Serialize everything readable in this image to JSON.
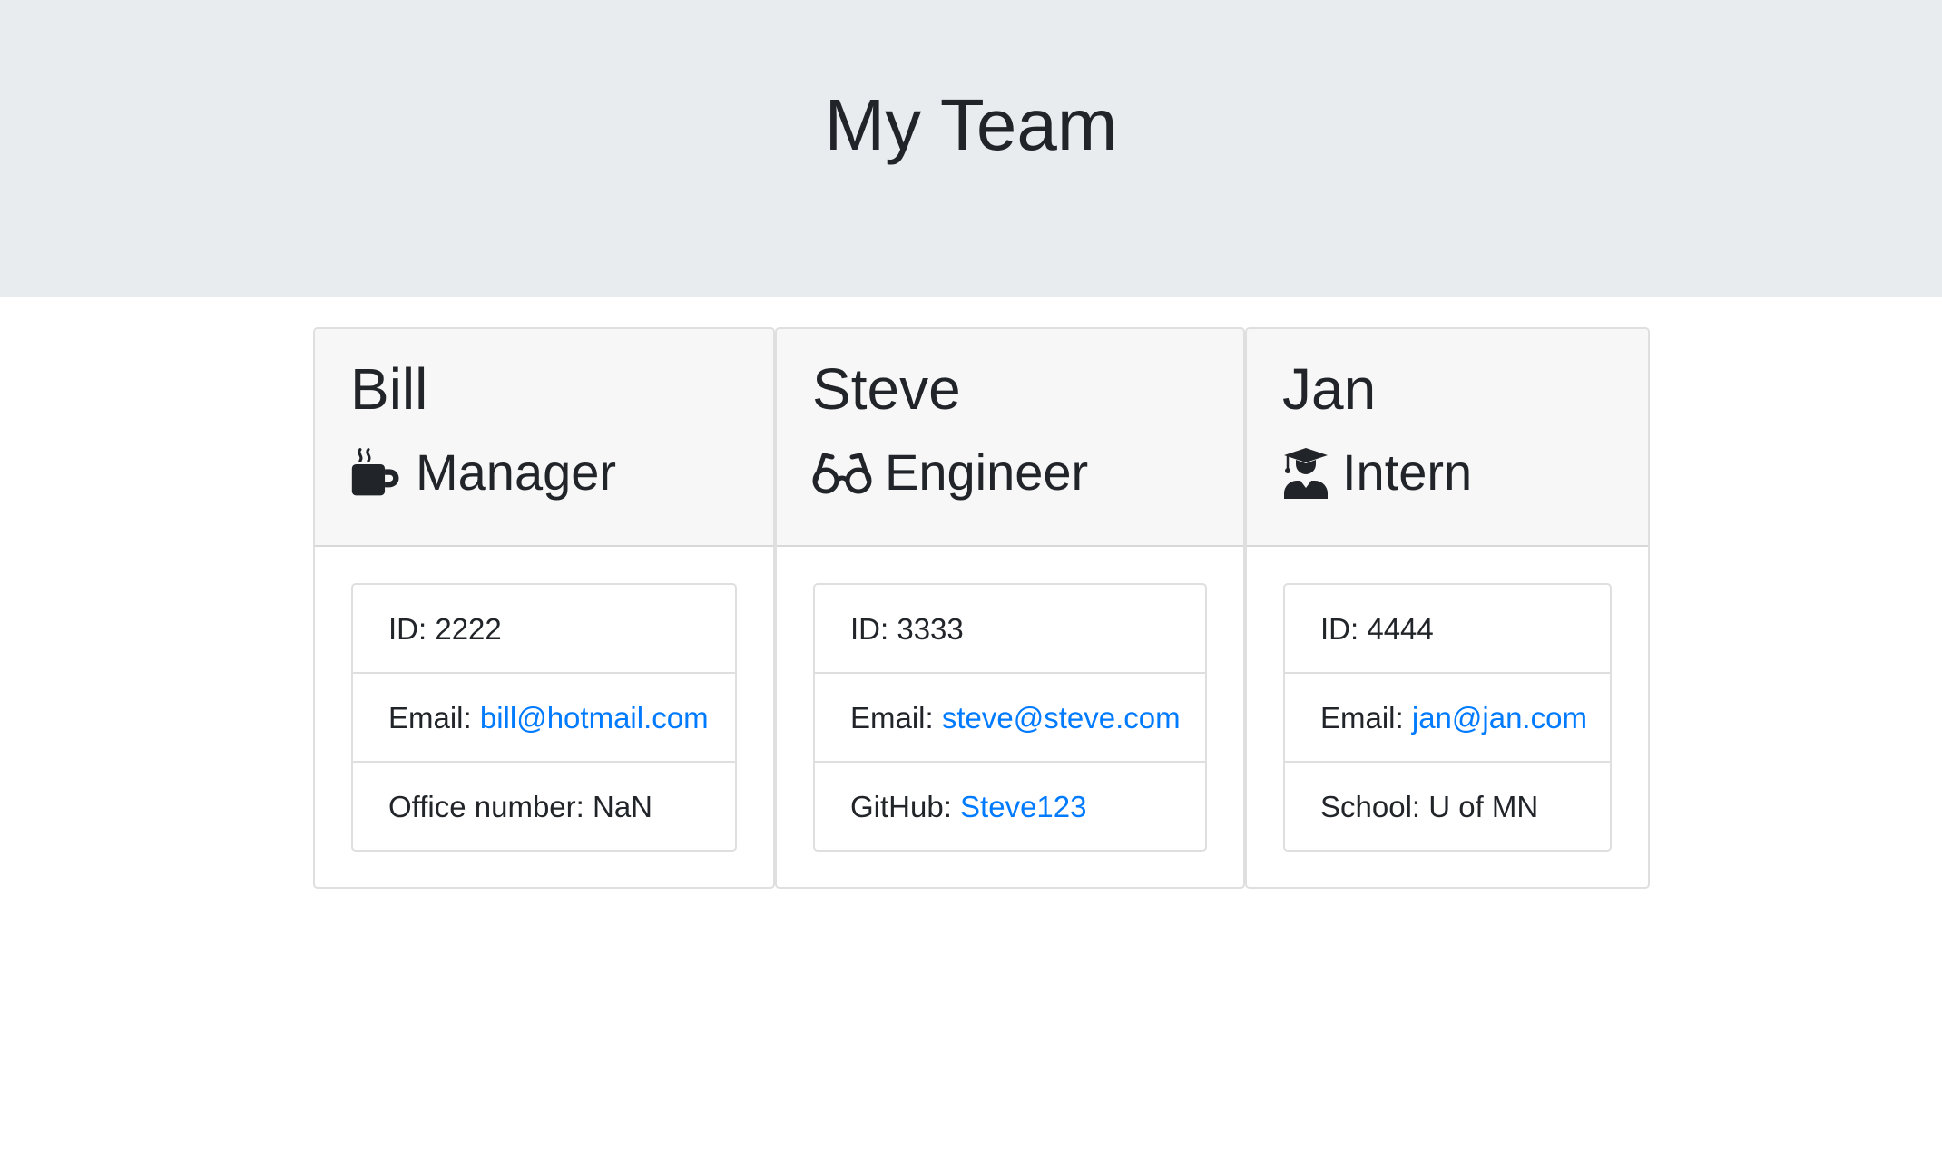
{
  "header": {
    "title": "My Team"
  },
  "colors": {
    "accent_link": "#007bff",
    "jumbotron_bg": "#e9ecef",
    "card_header_bg": "#f7f7f7"
  },
  "cards": [
    {
      "name": "Bill",
      "role": "Manager",
      "role_icon": "mug-hot-icon",
      "id_label": "ID: 2222",
      "email_label": "Email: ",
      "email": "bill@hotmail.com",
      "extra_label": "Office number: NaN"
    },
    {
      "name": "Steve",
      "role": "Engineer",
      "role_icon": "glasses-icon",
      "id_label": "ID: 3333",
      "email_label": "Email: ",
      "email": "steve@steve.com",
      "extra_label": "GitHub: ",
      "extra_link": "Steve123"
    },
    {
      "name": "Jan",
      "role": "Intern",
      "role_icon": "user-graduate-icon",
      "id_label": "ID: 4444",
      "email_label": "Email: ",
      "email": "jan@jan.com",
      "extra_label": "School: U of MN"
    }
  ]
}
